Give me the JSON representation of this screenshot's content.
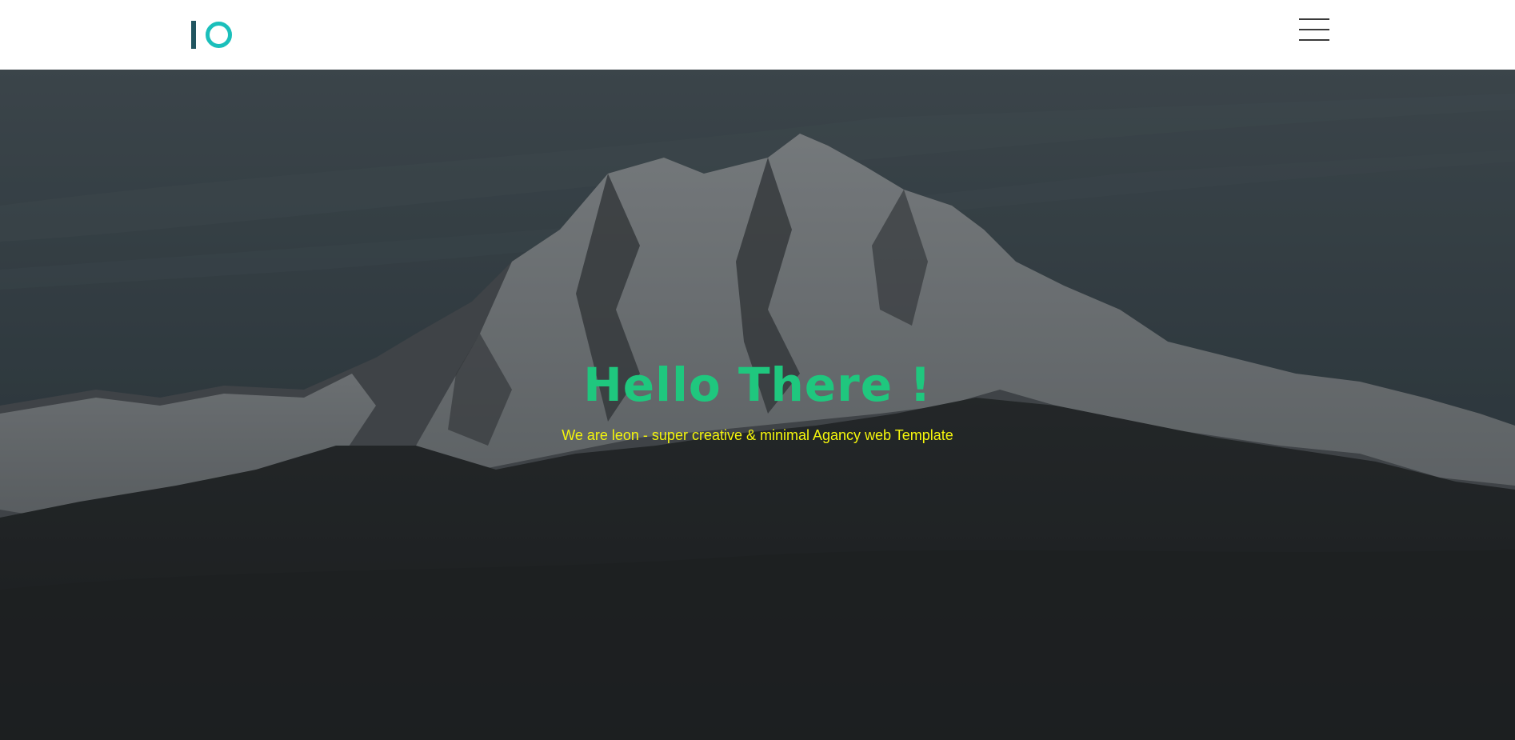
{
  "header": {
    "logo_text": "IO",
    "menu_icon": "hamburger-icon"
  },
  "hero": {
    "title": "Hello There !",
    "subtitle": "We are leon - super creative & minimal Agancy web Template",
    "background": "snowy-mountain-photo"
  },
  "colors": {
    "title": "#1fc77e",
    "subtitle": "#f4f50c",
    "logo_i": "#205560",
    "logo_o": "#1bbfbb",
    "header_bg": "#ffffff"
  }
}
